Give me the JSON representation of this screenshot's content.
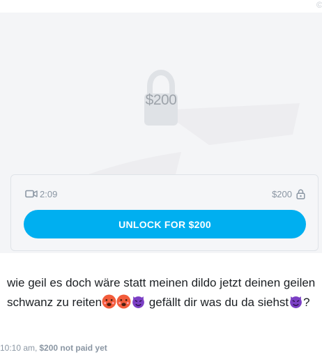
{
  "media": {
    "lock_price": "$200",
    "duration": "2:09",
    "price": "$200",
    "unlock_label": "UNLOCK FOR $200",
    "icons": {
      "video": "video-camera-icon",
      "lock": "lock-icon",
      "large_lock": "padlock-icon"
    }
  },
  "message": {
    "text_part1": "wie geil es doch wäre statt meinen dildo jetzt deinen geilen schwanz zu reiten",
    "text_part2": " gefällt dir was du da siehst",
    "text_part3": "?",
    "emojis": [
      "face-with-hot-cheeks",
      "face-with-hot-cheeks",
      "purple-devil"
    ]
  },
  "meta": {
    "time": "10:10 am,",
    "status": "$200 not paid yet"
  },
  "colors": {
    "accent": "#00aff0",
    "muted": "#8a96a3",
    "text": "#1b1f23",
    "card_bg": "#f5f6f8",
    "devil": "#7b3fc4"
  }
}
